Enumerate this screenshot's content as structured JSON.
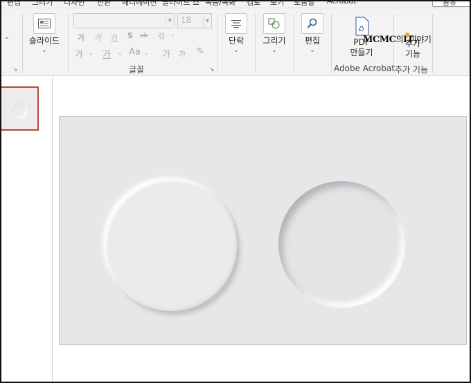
{
  "tabs": [
    "편집",
    "그리기",
    "디자인",
    "전환",
    "애니메이션",
    "슬라이드 쇼",
    "녹음/녹화",
    "검토",
    "보기",
    "도움말",
    "Acrobat"
  ],
  "share_label": "공유",
  "ribbon": {
    "slides_group": {
      "button_label": "슬라이드"
    },
    "font_group": {
      "font_name": "",
      "font_size": "18",
      "format_row1": [
        "가",
        "가",
        "가",
        "S",
        "ab",
        "갂"
      ],
      "format_row2": [
        "가",
        "가",
        "Aa",
        "가",
        "가",
        "지우기"
      ],
      "label": "글꼴"
    },
    "paragraph_button": "단락",
    "drawing_button": "그리기",
    "editing_button": "편집",
    "acrobat": {
      "button_line1": "PDF",
      "button_line2": "만들기",
      "group_label": "Adobe Acrobat"
    },
    "addins": {
      "button_line1": "추가",
      "button_line2": "기능",
      "group_label": "추가 기능"
    }
  },
  "watermark": {
    "brand": "MCMC",
    "mid": "의",
    "it": "IT",
    "tail": "이야기"
  },
  "colors": {
    "thumb_selection": "#b7472a",
    "slide_bg": "#e7e7ea",
    "ribbon_bg": "#f3f3f3"
  }
}
